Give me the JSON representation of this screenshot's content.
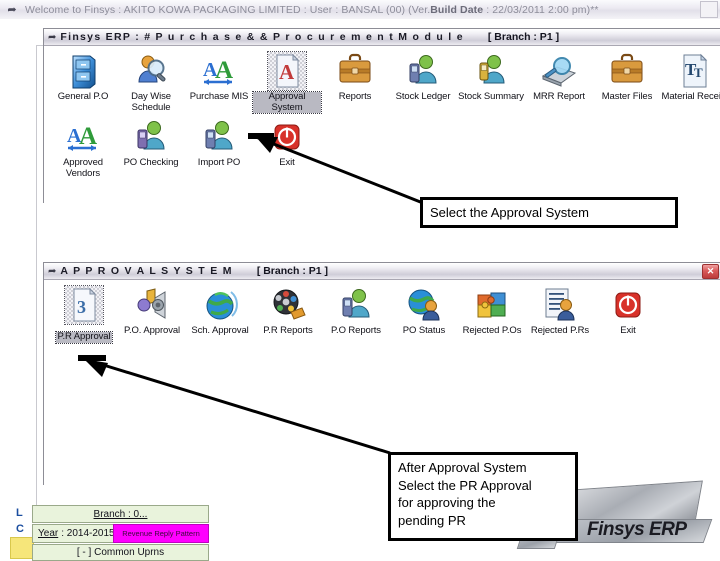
{
  "app_titlebar": {
    "icon": "window-restore-icon",
    "text_a": "Welcome to Finsys : AKITO KOWA PACKAGING LIMITED : User : BANSAL (00) (Ver.",
    "text_b": "Build Date",
    "text_c": " : 22/03/2011 2:00 pm)**"
  },
  "purchase_window": {
    "icon": "app-window-icon",
    "title": "Finsys ERP : # P u r c h a s e  & &  P r o c u r e m e n t   M o d u l e",
    "branch": "[ Branch : P1 ]",
    "icons": [
      {
        "label": "General P.O",
        "icon": "filing-cabinet-icon",
        "selected": false
      },
      {
        "label": "Day Wise Schedule",
        "icon": "person-magnifier-icon",
        "selected": false
      },
      {
        "label": "Purchase MIS",
        "icon": "double-a-arrow-icon",
        "selected": false
      },
      {
        "label": "Approval System",
        "icon": "document-a-icon",
        "selected": true
      },
      {
        "label": "Reports",
        "icon": "briefcase-icon",
        "selected": false
      },
      {
        "label": "Stock Ledger",
        "icon": "person-phone-icon",
        "selected": false
      },
      {
        "label": "Stock Summary",
        "icon": "person-phone-icon",
        "selected": false
      },
      {
        "label": "MRR Report",
        "icon": "magnifier-disk-icon",
        "selected": false
      },
      {
        "label": "Master Files",
        "icon": "briefcase-icon",
        "selected": false
      },
      {
        "label": "Material Recei...",
        "icon": "text-document-icon",
        "selected": false
      },
      {
        "label": "Approved Vendors",
        "icon": "double-a-arrow-icon",
        "selected": false
      },
      {
        "label": "PO Checking",
        "icon": "person-phone-icon",
        "selected": false
      },
      {
        "label": "Import PO",
        "icon": "person-phone-icon",
        "selected": false
      },
      {
        "label": "Exit",
        "icon": "power-exit-icon",
        "selected": false
      }
    ]
  },
  "approval_window": {
    "icon": "app-window-icon",
    "title": "A P P R O V A L   S Y S T E M",
    "branch": "[ Branch : P1 ]",
    "close_label": "✕",
    "icons": [
      {
        "label": "P.R Approval",
        "icon": "document-list-icon",
        "selected": true
      },
      {
        "label": "P.O. Approval",
        "icon": "music-speaker-icon",
        "selected": false
      },
      {
        "label": "Sch. Approval",
        "icon": "globe-icon",
        "selected": false
      },
      {
        "label": "P.R Reports",
        "icon": "film-reel-icon",
        "selected": false
      },
      {
        "label": "P.O Reports",
        "icon": "person-phone-icon",
        "selected": false
      },
      {
        "label": "PO Status",
        "icon": "globe-person-icon",
        "selected": false
      },
      {
        "label": "Rejected P.Os",
        "icon": "puzzle-icon",
        "selected": false
      },
      {
        "label": "Rejected P.Rs",
        "icon": "list-person-icon",
        "selected": false
      },
      {
        "label": "Exit",
        "icon": "power-exit-icon",
        "selected": false
      }
    ]
  },
  "callouts": {
    "first": "Select the Approval System",
    "second_lines": [
      "After Approval System",
      "Select the PR Approval",
      "for approving the",
      "pending PR"
    ]
  },
  "bottom": {
    "letter_l": "L",
    "letter_c": "C",
    "branch_box": "Branch : 0...",
    "year_label": "Year",
    "year_value": ": 2014-2015",
    "magenta_button": "Revenue Reply Pattern",
    "common_box": "[ - ] Common Uprns",
    "watermark": "Finsys ERP"
  },
  "colors": {
    "callout_border": "#000000",
    "selected_label_bg": "#b9b9c2",
    "magenta": "#ff00ff",
    "cyan": "#9fe3ef",
    "yellow": "#f6e67a",
    "green_box": "#e9f3dc",
    "close_red": "#bc3b3b"
  }
}
